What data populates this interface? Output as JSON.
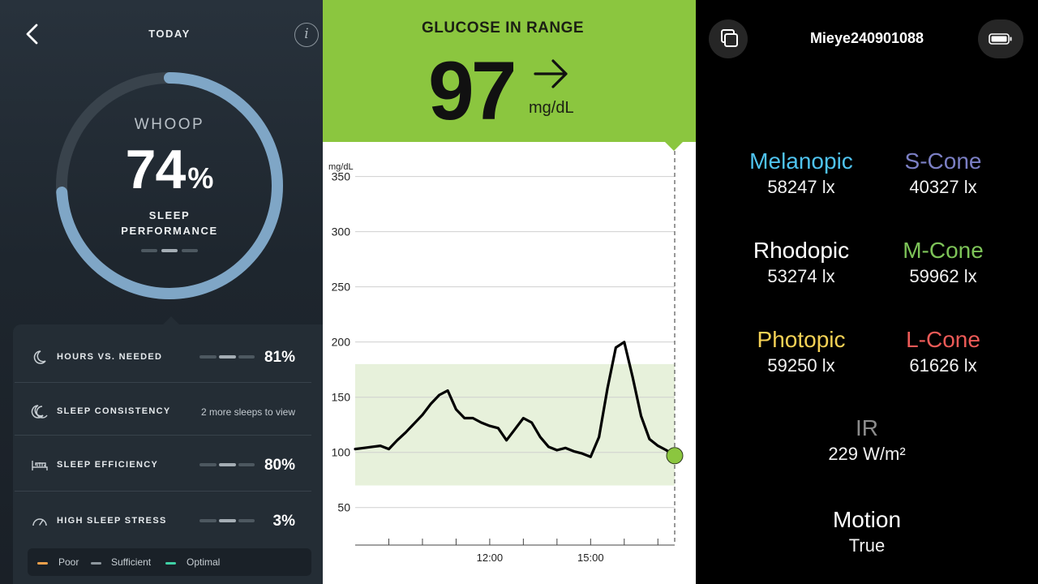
{
  "whoop": {
    "header_title": "TODAY",
    "info_glyph": "i",
    "brand": "WHOOP",
    "score_value": "74",
    "score_unit": "%",
    "score_fraction": 0.74,
    "score_label_line1": "SLEEP",
    "score_label_line2": "PERFORMANCE",
    "metrics": [
      {
        "label": "HOURS VS. NEEDED",
        "value": "81%",
        "icon": "moon-crescent-icon"
      },
      {
        "label": "SLEEP CONSISTENCY",
        "value": "2 more sleeps to view",
        "icon": "double-moon-icon"
      },
      {
        "label": "SLEEP EFFICIENCY",
        "value": "80%",
        "icon": "bed-icon"
      },
      {
        "label": "HIGH SLEEP STRESS",
        "value": "3%",
        "icon": "gauge-icon"
      }
    ],
    "legend": [
      {
        "label": "Poor",
        "color": "#f0a04b"
      },
      {
        "label": "Sufficient",
        "color": "#8e979e"
      },
      {
        "label": "Optimal",
        "color": "#3fd1a5"
      }
    ],
    "ring_color": "#7fa6c6"
  },
  "glucose": {
    "title": "GLUCOSE IN RANGE",
    "value": "97",
    "unit": "mg/dL",
    "trend_icon": "arrow-right-icon",
    "header_color": "#8bc63f"
  },
  "chart_data": {
    "type": "line",
    "ylabel": "mg/dL",
    "y_ticks": [
      50,
      100,
      150,
      200,
      250,
      300,
      350
    ],
    "x_tick_labels": [
      "12:00",
      "15:00"
    ],
    "target_range": [
      70,
      180
    ],
    "xlim": [
      8.0,
      17.5
    ],
    "ylim": [
      50,
      350
    ],
    "series": [
      {
        "x": [
          8.0,
          8.25,
          8.5,
          8.75,
          9.0,
          9.25,
          9.5,
          9.75,
          10.0,
          10.25,
          10.5,
          10.75,
          11.0,
          11.25,
          11.5,
          11.75,
          12.0,
          12.25,
          12.5,
          12.75,
          13.0,
          13.25,
          13.5,
          13.75,
          14.0,
          14.25,
          14.5,
          14.75,
          15.0,
          15.25,
          15.5,
          15.75,
          16.0,
          16.25,
          16.5,
          16.75,
          17.0,
          17.25,
          17.5
        ],
        "y": [
          103,
          104,
          105,
          106,
          103,
          111,
          118,
          126,
          134,
          144,
          152,
          156,
          139,
          131,
          131,
          127,
          124,
          122,
          111,
          121,
          131,
          127,
          114,
          105,
          102,
          104,
          101,
          99,
          96,
          114,
          158,
          195,
          200,
          168,
          133,
          112,
          106,
          102,
          97
        ]
      }
    ],
    "current_value": 97
  },
  "sensor": {
    "device_name": "Mieye240901088",
    "readings": [
      {
        "name": "Melanopic",
        "value": "58247 lx",
        "color": "#4fc3ef"
      },
      {
        "name": "S-Cone",
        "value": "40327 lx",
        "color": "#7b7fc4"
      },
      {
        "name": "Rhodopic",
        "value": "53274 lx",
        "color": "#ffffff"
      },
      {
        "name": "M-Cone",
        "value": "59962 lx",
        "color": "#7dc358"
      },
      {
        "name": "Photopic",
        "value": "59250 lx",
        "color": "#f4d155"
      },
      {
        "name": "L-Cone",
        "value": "61626 lx",
        "color": "#ec5a57"
      },
      {
        "name": "IR",
        "value": "229 W/m²",
        "color": "#8c8c8c"
      },
      {
        "name": "Motion",
        "value": "True",
        "color": "#ffffff"
      }
    ]
  }
}
